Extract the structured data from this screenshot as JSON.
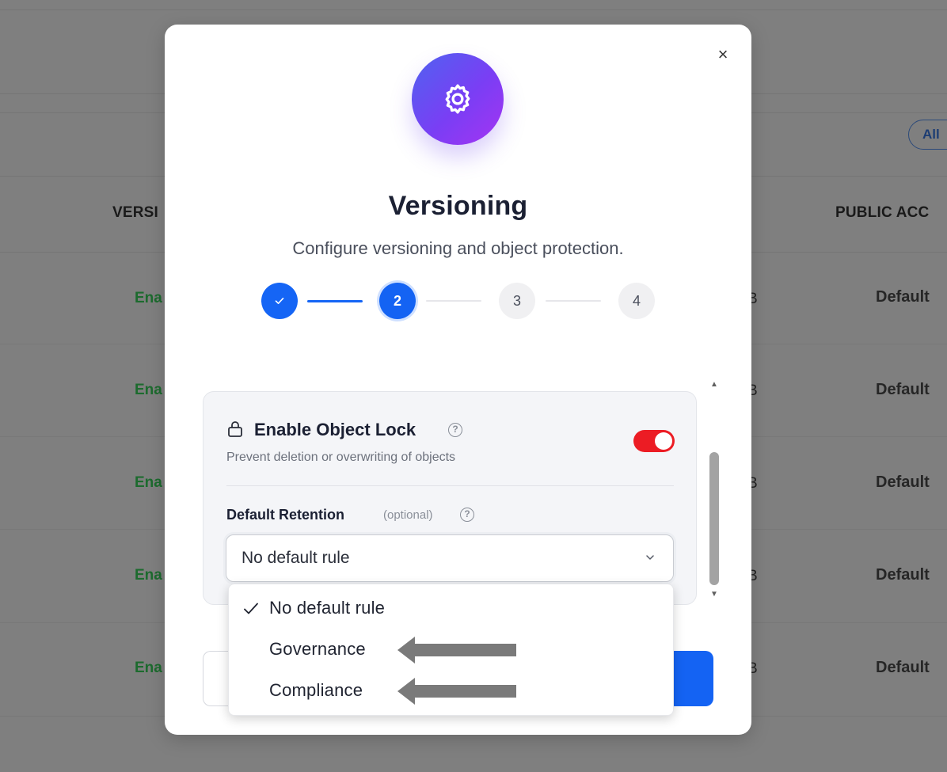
{
  "background": {
    "header_versioning": "VERSI",
    "header_public_access": "PUBLIC ACC",
    "filter_all": "All",
    "rows": [
      {
        "status": "Ena",
        "size": "B",
        "access": "Default"
      },
      {
        "status": "Ena",
        "size": "B",
        "access": "Default"
      },
      {
        "status": "Ena",
        "size": "B",
        "access": "Default"
      },
      {
        "status": "Ena",
        "size": "B",
        "access": "Default"
      },
      {
        "status": "Ena",
        "size": "B",
        "access": "Default"
      }
    ]
  },
  "modal": {
    "close_label": "×",
    "icon": "gear-icon",
    "title": "Versioning",
    "subtitle": "Configure versioning and object protection.",
    "steps": [
      {
        "label": "✓",
        "state": "done"
      },
      {
        "label": "2",
        "state": "active"
      },
      {
        "label": "3",
        "state": "todo"
      },
      {
        "label": "4",
        "state": "todo"
      }
    ],
    "object_lock": {
      "title": "Enable Object Lock",
      "description": "Prevent deletion or overwriting of objects",
      "enabled": true
    },
    "retention": {
      "label": "Default Retention",
      "optional": "(optional)",
      "selected": "No default rule",
      "options": [
        "No default rule",
        "Governance",
        "Compliance"
      ]
    }
  },
  "colors": {
    "primary": "#1463f3",
    "toggle_on": "#ec1c24",
    "gradient_start": "#4f63f0",
    "gradient_end": "#a534f2",
    "arrow": "#7a7a7a"
  }
}
